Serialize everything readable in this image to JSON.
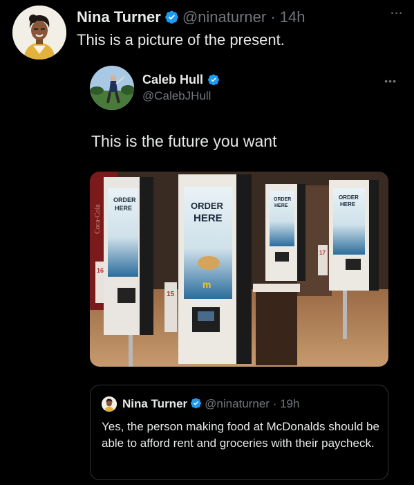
{
  "tweet": {
    "author_name": "Nina Turner",
    "author_handle": "@ninaturner",
    "separator": "·",
    "time": "14h",
    "text": "This is a picture of the present.",
    "more_icon": "more-vertical-icon"
  },
  "quoted": {
    "author_name": "Caleb Hull",
    "author_handle": "@CalebJHull",
    "text": "This is the future you want",
    "more_icon": "more-horizontal-icon",
    "image_signs": [
      "ORDER",
      "HERE"
    ],
    "image_brand_text": "Coca-Cola",
    "image_kiosk_numbers": [
      "16",
      "15",
      "17"
    ]
  },
  "nested": {
    "author_name": "Nina Turner",
    "author_handle": "@ninaturner",
    "separator": "·",
    "time": "19h",
    "text": "Yes, the person making food at McDonalds should be able to afford rent and groceries with their paycheck."
  },
  "colors": {
    "background": "#000000",
    "text_primary": "#e7e9ea",
    "text_secondary": "#71767b",
    "verified_blue": "#1d9bf0",
    "border": "#2f3336"
  }
}
